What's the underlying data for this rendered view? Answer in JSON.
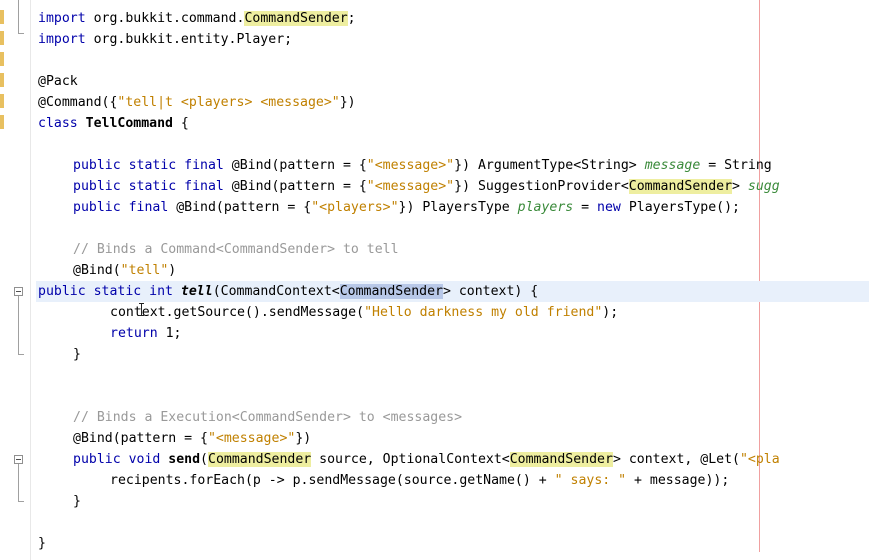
{
  "editor": {
    "lines": [
      {
        "id": "l1",
        "parts": [
          [
            "kw",
            "import "
          ],
          [
            "t",
            "org.bukkit.command."
          ],
          [
            "hl",
            "CommandSender"
          ],
          [
            "t",
            ";"
          ]
        ]
      },
      {
        "id": "l2",
        "parts": [
          [
            "kw",
            "import "
          ],
          [
            "t",
            "org.bukkit.entity.Player;"
          ]
        ]
      },
      {
        "id": "l3",
        "parts": []
      },
      {
        "id": "l4",
        "parts": [
          [
            "t",
            "@Pack"
          ]
        ]
      },
      {
        "id": "l5",
        "parts": [
          [
            "t",
            "@Command({"
          ],
          [
            "str",
            "\"tell|t <players> <message>\""
          ],
          [
            "t",
            "})"
          ]
        ]
      },
      {
        "id": "l6",
        "parts": [
          [
            "kw",
            "class "
          ],
          [
            "bold",
            "TellCommand"
          ],
          [
            "t",
            " {"
          ]
        ]
      },
      {
        "id": "l7",
        "parts": []
      },
      {
        "id": "l8",
        "indent": 1,
        "parts": [
          [
            "kw",
            "public static final "
          ],
          [
            "t",
            "@Bind(pattern = {"
          ],
          [
            "str",
            "\"<message>\""
          ],
          [
            "t",
            "}) ArgumentType<String> "
          ],
          [
            "it",
            "message"
          ],
          [
            "t",
            " = String"
          ]
        ]
      },
      {
        "id": "l9",
        "indent": 1,
        "parts": [
          [
            "kw",
            "public static final "
          ],
          [
            "t",
            "@Bind(pattern = {"
          ],
          [
            "str",
            "\"<message>\""
          ],
          [
            "t",
            "}) SuggestionProvider<"
          ],
          [
            "hl",
            "CommandSender"
          ],
          [
            "t",
            "> "
          ],
          [
            "it",
            "sugg"
          ]
        ]
      },
      {
        "id": "l10",
        "indent": 1,
        "parts": [
          [
            "kw",
            "public final "
          ],
          [
            "t",
            "@Bind(pattern = {"
          ],
          [
            "str",
            "\"<players>\""
          ],
          [
            "t",
            "}) PlayersType "
          ],
          [
            "it",
            "players"
          ],
          [
            "t",
            " = "
          ],
          [
            "kw",
            "new "
          ],
          [
            "t",
            "PlayersType();"
          ]
        ]
      },
      {
        "id": "l11",
        "parts": []
      },
      {
        "id": "l12",
        "indent": 1,
        "parts": [
          [
            "cm",
            "// Binds a Command<CommandSender> to tell"
          ]
        ]
      },
      {
        "id": "l13",
        "indent": 1,
        "parts": [
          [
            "t",
            "@Bind("
          ],
          [
            "str",
            "\"tell\""
          ],
          [
            "t",
            ")"
          ]
        ]
      },
      {
        "id": "l14",
        "indent": 1,
        "cur": true,
        "parts": [
          [
            "kw",
            "public static int "
          ],
          [
            "bi",
            "tell"
          ],
          [
            "t",
            "(CommandContext<"
          ],
          [
            "sel",
            "CommandSender"
          ],
          [
            "t",
            "> context) {"
          ]
        ]
      },
      {
        "id": "l15",
        "indent": 2,
        "parts": [
          [
            "t",
            "context.getSource().sendMessage("
          ],
          [
            "str",
            "\"Hello darkness my old friend\""
          ],
          [
            "t",
            ");"
          ]
        ]
      },
      {
        "id": "l16",
        "indent": 2,
        "parts": [
          [
            "kw",
            "return "
          ],
          [
            "t",
            "1;"
          ]
        ]
      },
      {
        "id": "l17",
        "indent": 1,
        "parts": [
          [
            "t",
            "}"
          ]
        ]
      },
      {
        "id": "l18",
        "parts": []
      },
      {
        "id": "l19",
        "parts": []
      },
      {
        "id": "l20",
        "indent": 1,
        "parts": [
          [
            "cm",
            "// Binds a Execution<CommandSender> to <messages>"
          ]
        ]
      },
      {
        "id": "l21",
        "indent": 1,
        "parts": [
          [
            "t",
            "@Bind(pattern = {"
          ],
          [
            "str",
            "\"<message>\""
          ],
          [
            "t",
            "})"
          ]
        ]
      },
      {
        "id": "l22",
        "indent": 1,
        "parts": [
          [
            "kw",
            "public void "
          ],
          [
            "bold",
            "send"
          ],
          [
            "t",
            "("
          ],
          [
            "hl",
            "CommandSender"
          ],
          [
            "t",
            " source, OptionalContext<"
          ],
          [
            "hl",
            "CommandSender"
          ],
          [
            "t",
            "> context, @Let("
          ],
          [
            "str",
            "\"<pla"
          ]
        ]
      },
      {
        "id": "l23",
        "indent": 2,
        "parts": [
          [
            "t",
            "recipents.forEach(p -> p.sendMessage(source.getName() + "
          ],
          [
            "str",
            "\" says: \""
          ],
          [
            "t",
            " + message));"
          ]
        ]
      },
      {
        "id": "l24",
        "indent": 1,
        "parts": [
          [
            "t",
            "}"
          ]
        ]
      },
      {
        "id": "l25",
        "parts": []
      },
      {
        "id": "l26",
        "parts": [
          [
            "t",
            "}"
          ]
        ]
      }
    ]
  }
}
